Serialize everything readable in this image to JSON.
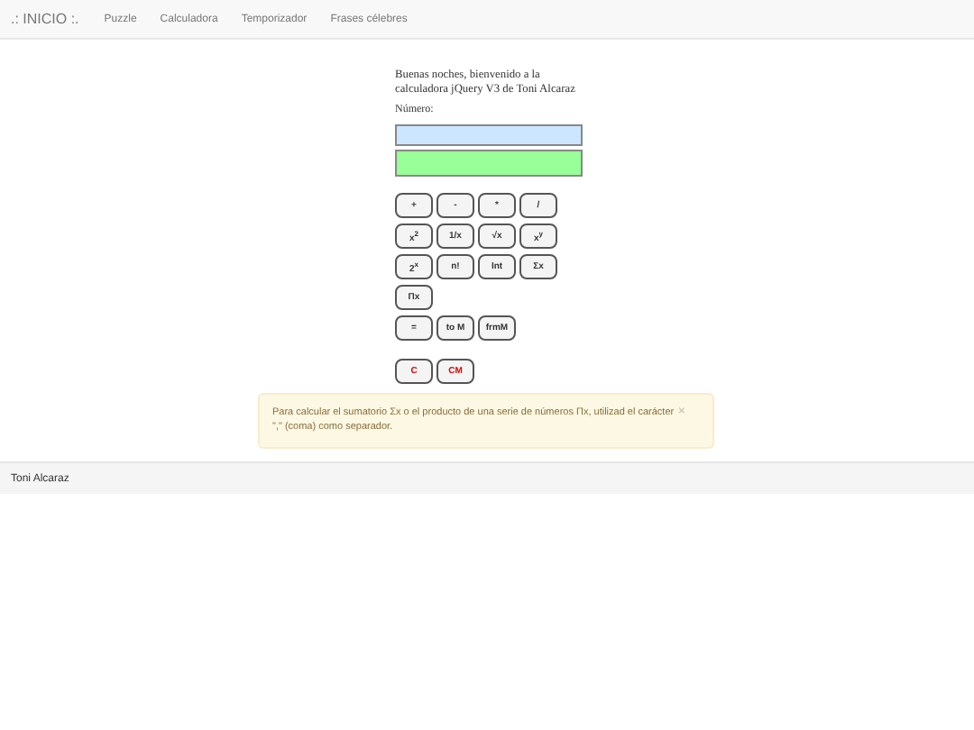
{
  "navbar": {
    "brand": ".: INICIO :.",
    "links": [
      "Puzzle",
      "Calculadora",
      "Temporizador",
      "Frases célebres"
    ]
  },
  "greeting": "Buenas noches, bienvenido a la calculadora jQuery V3 de Toni Alcaraz",
  "number_label": "Número:",
  "fields": [
    {
      "kind": "input"
    },
    {
      "kind": "result"
    }
  ],
  "button_rows": [
    [
      {
        "label": "+",
        "kind": "normal"
      },
      {
        "label": "-",
        "kind": "normal"
      },
      {
        "label": "*",
        "kind": "normal"
      },
      {
        "label": "/",
        "kind": "normal"
      }
    ],
    [
      {
        "label": "x$^{2}$",
        "kind": "normal"
      },
      {
        "label": "1/x",
        "kind": "normal"
      },
      {
        "label": "√x",
        "kind": "normal"
      },
      {
        "label": "x$^{y}$",
        "kind": "normal"
      }
    ],
    [
      {
        "label": "2$^{x}$",
        "kind": "normal"
      },
      {
        "label": "n!",
        "kind": "normal"
      },
      {
        "label": "Int",
        "kind": "normal"
      },
      {
        "label": "Σx",
        "kind": "normal"
      }
    ],
    [
      {
        "label": "Πx",
        "kind": "normal"
      }
    ],
    [
      {
        "label": "=",
        "kind": "normal"
      },
      {
        "label": "to M",
        "kind": "normal"
      },
      {
        "label": "frmM",
        "kind": "normal"
      }
    ],
    [
      {
        "label": "C",
        "kind": "danger"
      },
      {
        "label": "CM",
        "kind": "danger"
      }
    ]
  ],
  "alert": {
    "text": "Para calcular el sumatorio Σx o el producto de una serie de números Πx, utilizad el carácter \",\" (coma) como separador.",
    "close": "×"
  },
  "footer": "Toni Alcaraz"
}
